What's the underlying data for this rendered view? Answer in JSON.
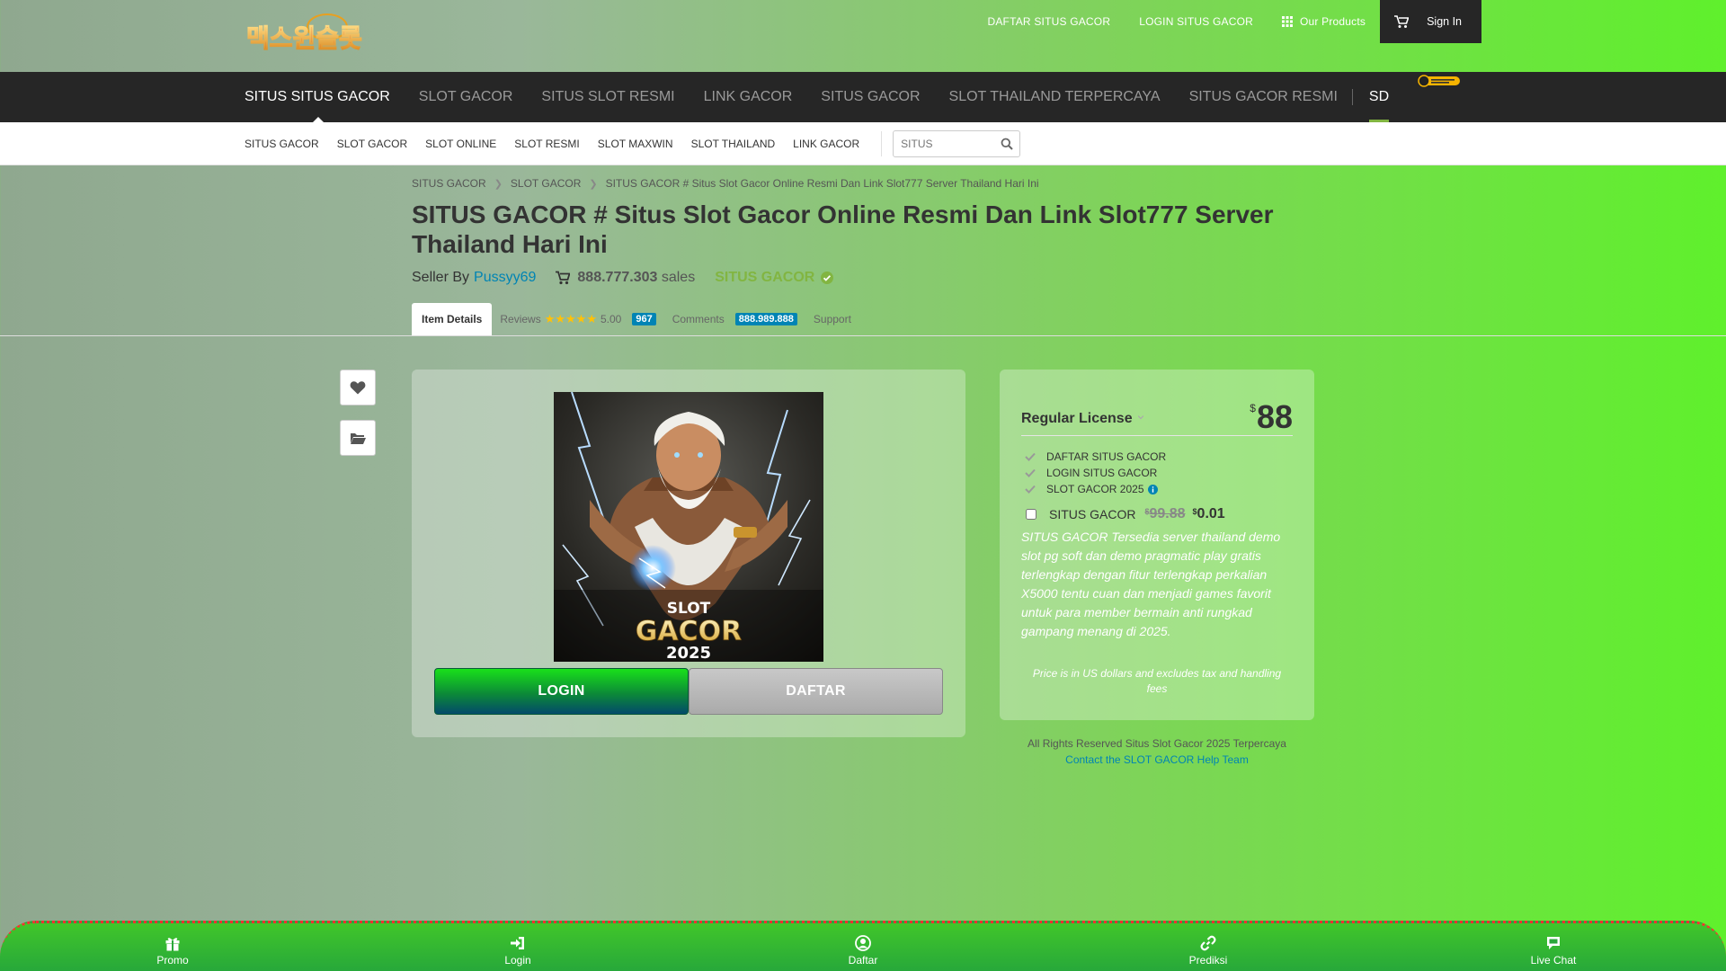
{
  "colors": {
    "accent_green": "#82b541",
    "link_blue": "#0084b4",
    "nav_dark": "#262626",
    "bottom_bar": "#27a83a"
  },
  "logo": {
    "text": "맥스윈슬롯"
  },
  "topnav": {
    "items": [
      "DAFTAR SITUS GACOR",
      "LOGIN SITUS GACOR"
    ],
    "products_label": "Our Products",
    "signin_label": "Sign In"
  },
  "mainnav": {
    "items": [
      "SITUS SITUS GACOR",
      "SLOT GACOR",
      "SITUS SLOT RESMI",
      "LINK GACOR",
      "SITUS GACOR",
      "SLOT THAILAND TERPERCAYA",
      "SITUS GACOR RESMI"
    ],
    "last": "SD"
  },
  "subnav": {
    "items": [
      "SITUS GACOR",
      "SLOT GACOR",
      "SLOT ONLINE",
      "SLOT RESMI",
      "SLOT MAXWIN",
      "SLOT THAILAND",
      "LINK GACOR"
    ],
    "search_placeholder": "SITUS"
  },
  "breadcrumb": [
    "SITUS GACOR",
    "SLOT GACOR",
    "SITUS GACOR # Situs Slot Gacor Online Resmi Dan Link Slot777 Server Thailand Hari Ini"
  ],
  "item": {
    "title": "SITUS GACOR # Situs Slot Gacor Online Resmi Dan Link Slot777 Server Thailand Hari Ini",
    "seller_prefix": "Seller By",
    "seller_name": "Pussyy69",
    "sales_count": "888.777.303",
    "sales_suffix": "sales",
    "elite_label": "SITUS GACOR"
  },
  "tabs": {
    "details": "Item Details",
    "reviews": "Reviews",
    "rating": "5.00",
    "reviews_count": "967",
    "comments": "Comments",
    "comments_count": "888.989.888",
    "support": "Support"
  },
  "artwork": {
    "line1": "SLOT",
    "line2": "GACOR",
    "line3": "2025"
  },
  "buttons": {
    "login": "LOGIN",
    "daftar": "DAFTAR"
  },
  "purchase": {
    "license": "Regular License",
    "currency": "$",
    "price": "88",
    "features": [
      "DAFTAR SITUS GACOR",
      "LOGIN SITUS GACOR",
      "SLOT GACOR 2025"
    ],
    "addon_label": "SITUS GACOR",
    "addon_old_price": "99.88",
    "addon_new_price": "0.01",
    "description": "SITUS GACOR Tersedia server thailand demo slot pg soft dan demo pragmatic play gratis terlengkap dengan fitur terlengkap perkalian X5000 tentu cuan dan menjadi games favorit untuk para member bermain anti rungkad gampang menang di 2025.",
    "price_note": "Price is in US dollars and excludes tax and handling fees"
  },
  "footer": {
    "rights": "All Rights Reserved Situs Slot Gacor 2025 Terpercaya",
    "help": "Contact the SLOT GACOR Help Team"
  },
  "bottombar": {
    "items": [
      {
        "label": "Promo",
        "icon": "gift-icon"
      },
      {
        "label": "Login",
        "icon": "login-icon"
      },
      {
        "label": "Daftar",
        "icon": "user-icon"
      },
      {
        "label": "Prediksi",
        "icon": "link-icon"
      },
      {
        "label": "Live Chat",
        "icon": "chat-icon"
      }
    ]
  }
}
